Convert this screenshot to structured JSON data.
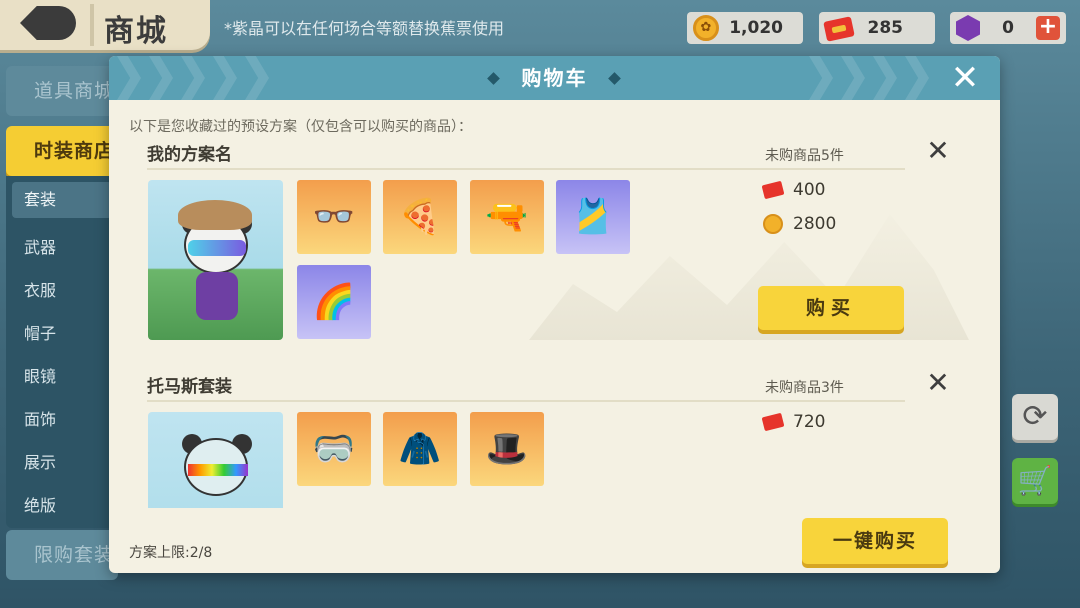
{
  "top_bar": {
    "title": "商城",
    "note": "*紫晶可以在任何场合等额替换蕉票使用",
    "currencies": [
      {
        "icon": "coin-icon",
        "value": "1,020"
      },
      {
        "icon": "ticket-icon",
        "value": "285"
      },
      {
        "icon": "gem-icon",
        "value": "0"
      }
    ],
    "add_label": "+"
  },
  "side_nav": {
    "main_items": [
      {
        "label": "道具商城",
        "active": false
      },
      {
        "label": "时装商店",
        "active": true
      },
      {
        "label": "限购套装",
        "active": false
      }
    ],
    "sub_items": [
      "套装",
      "武器",
      "衣服",
      "帽子",
      "眼镜",
      "面饰",
      "展示",
      "绝版"
    ],
    "selected_sub": "套装"
  },
  "right_tools": {
    "refresh_icon": "⟳",
    "cart_icon": "🛒"
  },
  "modal": {
    "title": "购物车",
    "close_label": "✕",
    "intro": "以下是您收藏过的预设方案（仅包含可以购买的商品）：",
    "plans": [
      {
        "name": "我的方案名",
        "unbought": "未购商品5件",
        "remove_label": "✕",
        "items": [
          {
            "name": "glasses-item",
            "glyph": "👓",
            "bg": "orange"
          },
          {
            "name": "pizza-box-item",
            "glyph": "🍕",
            "bg": "orange"
          },
          {
            "name": "rifle-item",
            "glyph": "🔫",
            "bg": "orange"
          },
          {
            "name": "rainbow-vest-item",
            "glyph": "🎽",
            "bg": "purple"
          },
          {
            "name": "rainbow-scarf-item",
            "glyph": "🌈",
            "bg": "purple"
          }
        ],
        "prices": [
          {
            "currency": "ticket",
            "value": "400"
          },
          {
            "currency": "coin",
            "value": "2800"
          }
        ],
        "buy_label": "购买"
      },
      {
        "name": "托马斯套装",
        "unbought": "未购商品3件",
        "remove_label": "✕",
        "items": [
          {
            "name": "eyepatch-item",
            "glyph": "🥽",
            "bg": "orange"
          },
          {
            "name": "fur-coat-item",
            "glyph": "🧥",
            "bg": "orange"
          },
          {
            "name": "top-hat-item",
            "glyph": "🎩",
            "bg": "orange"
          }
        ],
        "prices": [
          {
            "currency": "ticket",
            "value": "720"
          }
        ]
      }
    ],
    "limit_text": "方案上限:2/8",
    "buy_all_label": "一键购买"
  },
  "colors": {
    "header": "#5aa0b4",
    "panel": "#f4f1e3",
    "button_yellow": "#f8d43b",
    "nav_active": "#f5cd33"
  }
}
